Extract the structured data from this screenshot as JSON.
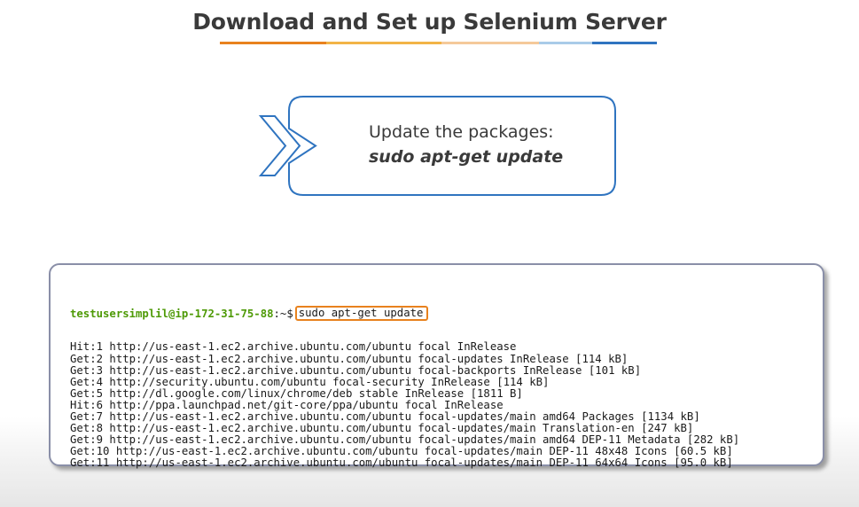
{
  "header": {
    "title": "Download and Set up Selenium Server",
    "underline_colors": [
      "#e8821e",
      "#f2b447",
      "#8cc63f",
      "#2f74c0"
    ]
  },
  "callout": {
    "instruction": "Update the packages:",
    "command": "sudo apt-get update",
    "border_color": "#2f74c0",
    "icon": "chevron-right-icon"
  },
  "terminal": {
    "prompt_user": "testusersimplil@ip-172-31-75-88",
    "prompt_suffix": ":~$",
    "command": "sudo apt-get update",
    "highlight_color": "#e8821e",
    "output_lines": [
      "Hit:1 http://us-east-1.ec2.archive.ubuntu.com/ubuntu focal InRelease",
      "Get:2 http://us-east-1.ec2.archive.ubuntu.com/ubuntu focal-updates InRelease [114 kB]",
      "Get:3 http://us-east-1.ec2.archive.ubuntu.com/ubuntu focal-backports InRelease [101 kB]",
      "Get:4 http://security.ubuntu.com/ubuntu focal-security InRelease [114 kB]",
      "Get:5 http://dl.google.com/linux/chrome/deb stable InRelease [1811 B]",
      "Hit:6 http://ppa.launchpad.net/git-core/ppa/ubuntu focal InRelease",
      "Get:7 http://us-east-1.ec2.archive.ubuntu.com/ubuntu focal-updates/main amd64 Packages [1134 kB]",
      "Get:8 http://us-east-1.ec2.archive.ubuntu.com/ubuntu focal-updates/main Translation-en [247 kB]",
      "Get:9 http://us-east-1.ec2.archive.ubuntu.com/ubuntu focal-updates/main amd64 DEP-11 Metadata [282 kB]",
      "Get:10 http://us-east-1.ec2.archive.ubuntu.com/ubuntu focal-updates/main DEP-11 48x48 Icons [60.5 kB]",
      "Get:11 http://us-east-1.ec2.archive.ubuntu.com/ubuntu focal-updates/main DEP-11 64x64 Icons [95.0 kB]"
    ]
  }
}
